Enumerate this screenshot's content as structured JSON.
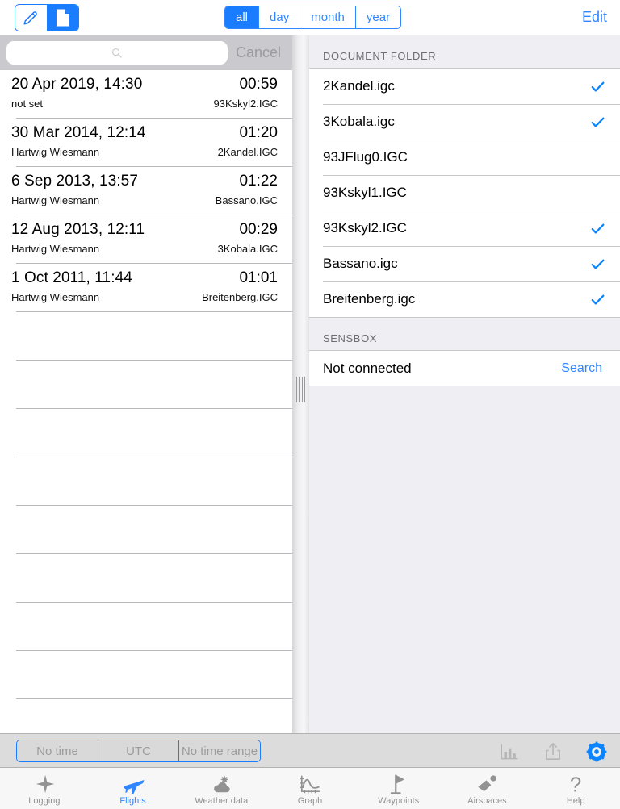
{
  "topbar": {
    "mode_segments": [
      {
        "id": "pencil",
        "icon": "pencil-icon",
        "selected": false
      },
      {
        "id": "document",
        "icon": "document-icon",
        "selected": true
      }
    ],
    "period_segments": [
      {
        "label": "all",
        "selected": true
      },
      {
        "label": "day",
        "selected": false
      },
      {
        "label": "month",
        "selected": false
      },
      {
        "label": "year",
        "selected": false
      }
    ],
    "edit_label": "Edit"
  },
  "search": {
    "value": "",
    "placeholder": "",
    "icon": "search-icon",
    "cancel_label": "Cancel"
  },
  "flights": [
    {
      "date": "20 Apr 2019, 14:30",
      "duration": "00:59",
      "pilot": "not set",
      "file": "93Kskyl2.IGC"
    },
    {
      "date": "30 Mar 2014, 12:14",
      "duration": "01:20",
      "pilot": "Hartwig Wiesmann",
      "file": "2Kandel.IGC"
    },
    {
      "date": "6 Sep 2013, 13:57",
      "duration": "01:22",
      "pilot": "Hartwig Wiesmann",
      "file": "Bassano.IGC"
    },
    {
      "date": "12 Aug 2013, 12:11",
      "duration": "00:29",
      "pilot": "Hartwig Wiesmann",
      "file": "3Kobala.IGC"
    },
    {
      "date": "1 Oct 2011, 11:44",
      "duration": "01:01",
      "pilot": "Hartwig Wiesmann",
      "file": "Breitenberg.IGC"
    }
  ],
  "empty_row_count": 8,
  "document_folder": {
    "header": "DOCUMENT FOLDER",
    "items": [
      {
        "name": "2Kandel.igc",
        "checked": true
      },
      {
        "name": "3Kobala.igc",
        "checked": true
      },
      {
        "name": "93JFlug0.IGC",
        "checked": false
      },
      {
        "name": "93Kskyl1.IGC",
        "checked": false
      },
      {
        "name": "93Kskyl2.IGC",
        "checked": true
      },
      {
        "name": "Bassano.igc",
        "checked": true
      },
      {
        "name": "Breitenberg.igc",
        "checked": true
      }
    ]
  },
  "sensbox": {
    "header": "SENSBOX",
    "status": "Not connected",
    "action_label": "Search"
  },
  "bottom_toolbar": {
    "time_segments": [
      {
        "label": "No time",
        "enabled": false
      },
      {
        "label": "UTC",
        "enabled": false
      },
      {
        "label": "No time range",
        "enabled": false
      }
    ],
    "icons": [
      {
        "name": "bar-chart-icon",
        "enabled": false
      },
      {
        "name": "share-icon",
        "enabled": false
      },
      {
        "name": "settings-gear-icon",
        "enabled": true
      }
    ]
  },
  "tabbar": {
    "tabs": [
      {
        "label": "Logging",
        "icon": "star-burst-icon",
        "active": false
      },
      {
        "label": "Flights",
        "icon": "airplane-icon",
        "active": true
      },
      {
        "label": "Weather data",
        "icon": "sun-cloud-icon",
        "active": false
      },
      {
        "label": "Graph",
        "icon": "line-graph-icon",
        "active": false
      },
      {
        "label": "Waypoints",
        "icon": "flag-icon",
        "active": false
      },
      {
        "label": "Airspaces",
        "icon": "airspace-icon",
        "active": false
      },
      {
        "label": "Help",
        "icon": "question-mark-icon",
        "active": false
      }
    ]
  },
  "colors": {
    "accent_blue": "#2f86ff",
    "selected_blue": "#1a7cff",
    "check_blue": "#0b84ff",
    "toolbar_gray": "#dcdcdc",
    "panel_gray": "#eeeef3",
    "search_gray": "#c9c9ce",
    "muted_text": "#9b9b9b"
  }
}
